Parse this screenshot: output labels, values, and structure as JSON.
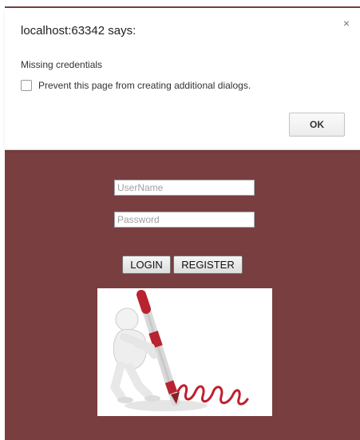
{
  "dialog": {
    "title": "localhost:63342 says:",
    "message": "Missing credentials",
    "checkbox_label": "Prevent this page from creating additional dialogs.",
    "ok_label": "OK",
    "close_symbol": "×"
  },
  "form": {
    "username_placeholder": "UserName",
    "password_placeholder": "Password",
    "login_label": "LOGIN",
    "register_label": "REGISTER"
  },
  "illustration": {
    "icon": "login-illustration-icon"
  },
  "colors": {
    "page_background": "#793e40",
    "dialog_background": "#ffffff",
    "pen_red": "#b8232f"
  }
}
